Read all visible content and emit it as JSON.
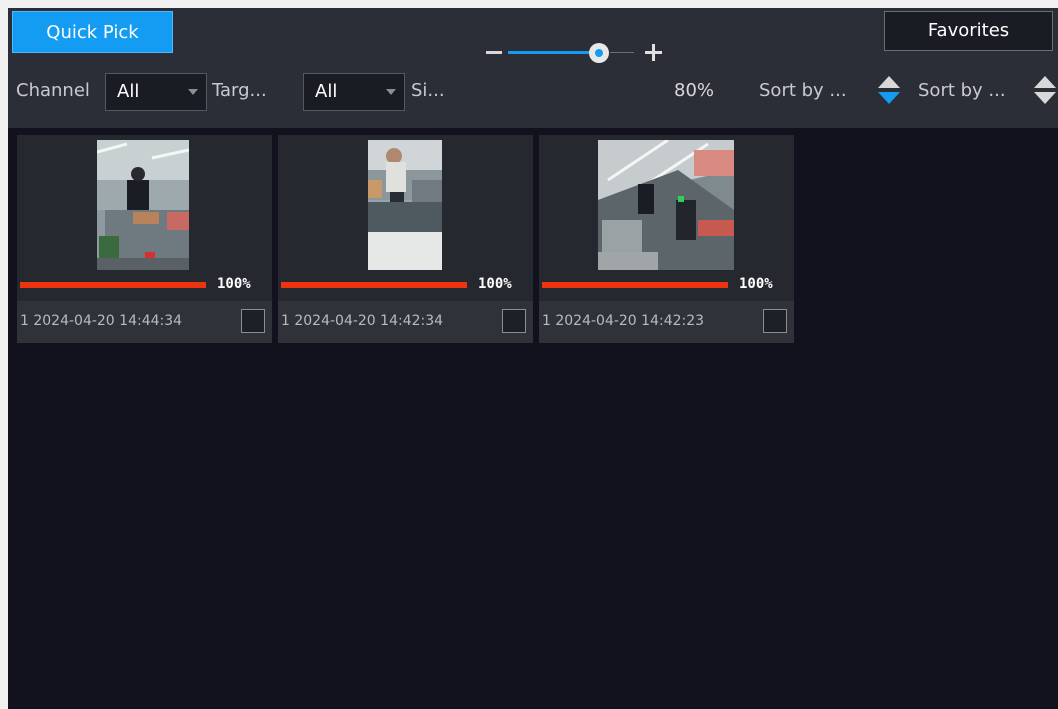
{
  "tabs": {
    "quick_pick": "Quick Pick",
    "favorites": "Favorites"
  },
  "filters": {
    "channel_label": "Channel",
    "channel_value": "All",
    "target_label": "Targ...",
    "target_value": "All",
    "size_label": "Si...",
    "zoom_percent": "80%",
    "zoom_level": 0.8,
    "sort_by_1": "Sort by ...",
    "sort_by_2": "Sort by ..."
  },
  "results": [
    {
      "progress_label": "100%",
      "progress": 1.0,
      "timestamp": "1 2024-04-20 14:44:34",
      "checked": false
    },
    {
      "progress_label": "100%",
      "progress": 1.0,
      "timestamp": "1 2024-04-20 14:42:34",
      "checked": false
    },
    {
      "progress_label": "100%",
      "progress": 1.0,
      "timestamp": "1 2024-04-20 14:42:23",
      "checked": false
    }
  ],
  "colors": {
    "accent": "#139cf2",
    "progress": "#ee3311",
    "background": "#11121e",
    "panel": "#2b2e36"
  }
}
